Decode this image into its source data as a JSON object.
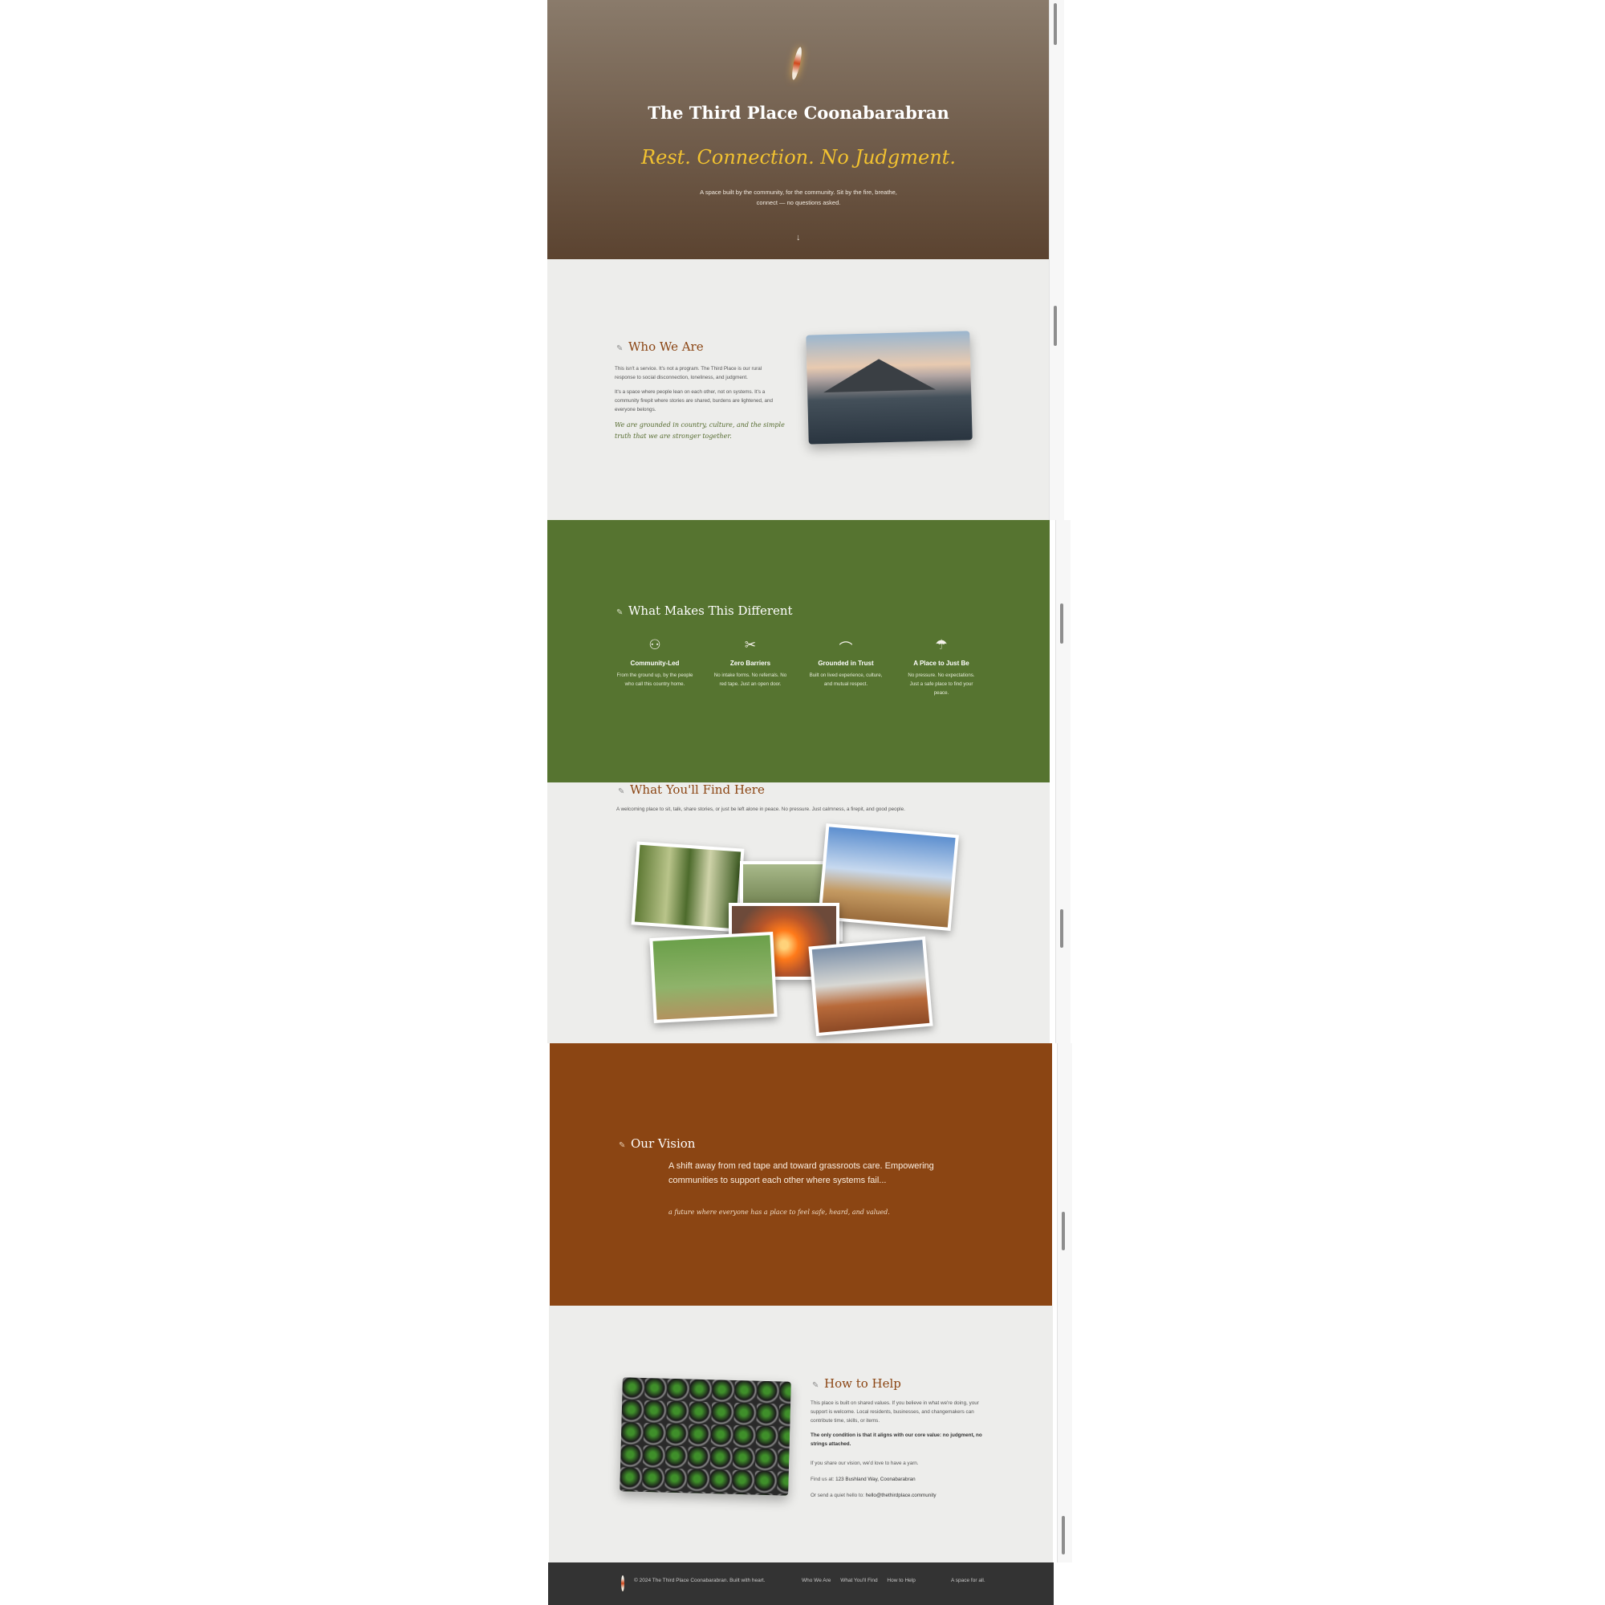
{
  "hero": {
    "title": "The Third Place Coonabarabran",
    "tagline": "Rest. Connection. No Judgment.",
    "description": "A space built by the community, for the community. Sit by the fire, breathe, connect — no questions asked.",
    "scroll_icon": "arrow-down-icon"
  },
  "who": {
    "heading": "Who We Are",
    "p1": "This isn't a service. It's not a program. The Third Place is our rural response to social disconnection, loneliness, and judgment.",
    "p2": "It's a space where people lean on each other, not on systems. It's a community firepit where stories are shared, burdens are lightened, and everyone belongs.",
    "quote": "We are grounded in country, culture, and the simple truth that we are stronger together."
  },
  "different": {
    "heading": "What Makes This Different",
    "features": [
      {
        "icon": "people-icon",
        "title": "Community-Led",
        "desc": "From the ground up, by the people who call this country home."
      },
      {
        "icon": "scissors-icon",
        "title": "Zero Barriers",
        "desc": "No intake forms. No referrals. No red tape. Just an open door."
      },
      {
        "icon": "rainbow-icon",
        "title": "Grounded in Trust",
        "desc": "Built on lived experience, culture, and mutual respect."
      },
      {
        "icon": "umbrella-icon",
        "title": "A Place to Just Be",
        "desc": "No pressure. No expectations. Just a safe place to find your peace."
      }
    ]
  },
  "find": {
    "heading": "What You'll Find Here",
    "intro": "A welcoming place to sit, talk, share stories, or just be left alone in peace. No pressure. Just calmness, a firepit, and good people."
  },
  "vision": {
    "heading": "Our Vision",
    "lead": "A shift away from red tape and toward grassroots care. Empowering communities to support each other where systems fail...",
    "sub": "a future where everyone has a place to feel safe, heard, and valued."
  },
  "help": {
    "heading": "How to Help",
    "p1": "This place is built on shared values. If you believe in what we're doing, your support is welcome. Local residents, businesses, and changemakers can contribute time, skills, or items.",
    "p2": "The only condition is that it aligns with our core value: no judgment, no strings attached.",
    "p3": "If you share our vision, we'd love to have a yarn.",
    "find_label": "Find us at:",
    "address": "123 Bushland Way, Coonabarabran",
    "email_label": "Or send a quiet hello to:",
    "email": "hello@thethirdplace.community"
  },
  "footer": {
    "copyright": "© 2024 The Third Place Coonabarabran. Built with heart.",
    "links": [
      "Who We Are",
      "What You'll Find",
      "How to Help"
    ],
    "tagline": "A space for all."
  },
  "colors": {
    "hero_top": "#8a7b6b",
    "hero_bottom": "#5b4330",
    "green": "#567430",
    "rust": "#8b4513",
    "gold": "#f2c230",
    "footer": "#333333",
    "light": "#ededeb"
  }
}
